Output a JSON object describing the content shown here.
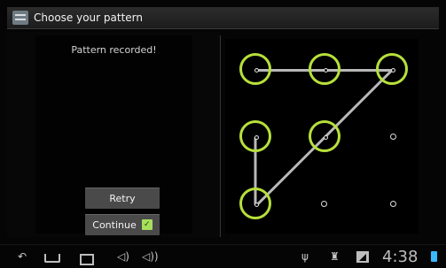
{
  "dialog": {
    "title": "Choose your pattern",
    "status_text": "Pattern recorded!",
    "retry_label": "Retry",
    "continue_label": "Continue"
  },
  "icons": {
    "app": "app-icon",
    "continue_check": "check-icon",
    "navigation": [
      "back-icon",
      "home-icon",
      "recent-apps-icon",
      "volume-down-icon",
      "volume-up-icon"
    ],
    "status": [
      "usb-icon",
      "android-debug-icon",
      "signal-icon",
      "battery-icon"
    ]
  },
  "statusbar": {
    "time": "4:38"
  },
  "colors": {
    "accent": "#b7e03b",
    "line": "#b8b8b8",
    "battery": "#39b7ff"
  }
}
